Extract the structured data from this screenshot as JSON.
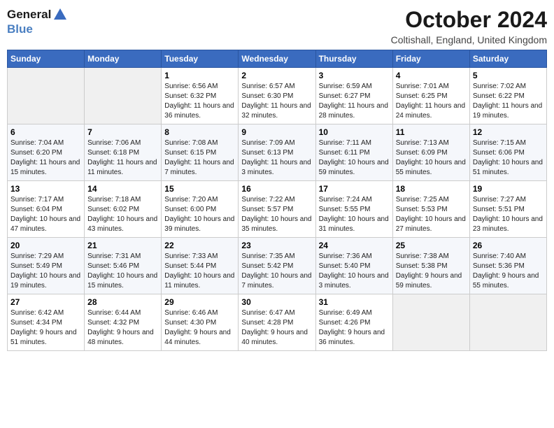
{
  "logo": {
    "general": "General",
    "blue": "Blue"
  },
  "title": "October 2024",
  "location": "Coltishall, England, United Kingdom",
  "headers": [
    "Sunday",
    "Monday",
    "Tuesday",
    "Wednesday",
    "Thursday",
    "Friday",
    "Saturday"
  ],
  "weeks": [
    [
      {
        "num": "",
        "info": ""
      },
      {
        "num": "",
        "info": ""
      },
      {
        "num": "1",
        "info": "Sunrise: 6:56 AM\nSunset: 6:32 PM\nDaylight: 11 hours and 36 minutes."
      },
      {
        "num": "2",
        "info": "Sunrise: 6:57 AM\nSunset: 6:30 PM\nDaylight: 11 hours and 32 minutes."
      },
      {
        "num": "3",
        "info": "Sunrise: 6:59 AM\nSunset: 6:27 PM\nDaylight: 11 hours and 28 minutes."
      },
      {
        "num": "4",
        "info": "Sunrise: 7:01 AM\nSunset: 6:25 PM\nDaylight: 11 hours and 24 minutes."
      },
      {
        "num": "5",
        "info": "Sunrise: 7:02 AM\nSunset: 6:22 PM\nDaylight: 11 hours and 19 minutes."
      }
    ],
    [
      {
        "num": "6",
        "info": "Sunrise: 7:04 AM\nSunset: 6:20 PM\nDaylight: 11 hours and 15 minutes."
      },
      {
        "num": "7",
        "info": "Sunrise: 7:06 AM\nSunset: 6:18 PM\nDaylight: 11 hours and 11 minutes."
      },
      {
        "num": "8",
        "info": "Sunrise: 7:08 AM\nSunset: 6:15 PM\nDaylight: 11 hours and 7 minutes."
      },
      {
        "num": "9",
        "info": "Sunrise: 7:09 AM\nSunset: 6:13 PM\nDaylight: 11 hours and 3 minutes."
      },
      {
        "num": "10",
        "info": "Sunrise: 7:11 AM\nSunset: 6:11 PM\nDaylight: 10 hours and 59 minutes."
      },
      {
        "num": "11",
        "info": "Sunrise: 7:13 AM\nSunset: 6:09 PM\nDaylight: 10 hours and 55 minutes."
      },
      {
        "num": "12",
        "info": "Sunrise: 7:15 AM\nSunset: 6:06 PM\nDaylight: 10 hours and 51 minutes."
      }
    ],
    [
      {
        "num": "13",
        "info": "Sunrise: 7:17 AM\nSunset: 6:04 PM\nDaylight: 10 hours and 47 minutes."
      },
      {
        "num": "14",
        "info": "Sunrise: 7:18 AM\nSunset: 6:02 PM\nDaylight: 10 hours and 43 minutes."
      },
      {
        "num": "15",
        "info": "Sunrise: 7:20 AM\nSunset: 6:00 PM\nDaylight: 10 hours and 39 minutes."
      },
      {
        "num": "16",
        "info": "Sunrise: 7:22 AM\nSunset: 5:57 PM\nDaylight: 10 hours and 35 minutes."
      },
      {
        "num": "17",
        "info": "Sunrise: 7:24 AM\nSunset: 5:55 PM\nDaylight: 10 hours and 31 minutes."
      },
      {
        "num": "18",
        "info": "Sunrise: 7:25 AM\nSunset: 5:53 PM\nDaylight: 10 hours and 27 minutes."
      },
      {
        "num": "19",
        "info": "Sunrise: 7:27 AM\nSunset: 5:51 PM\nDaylight: 10 hours and 23 minutes."
      }
    ],
    [
      {
        "num": "20",
        "info": "Sunrise: 7:29 AM\nSunset: 5:49 PM\nDaylight: 10 hours and 19 minutes."
      },
      {
        "num": "21",
        "info": "Sunrise: 7:31 AM\nSunset: 5:46 PM\nDaylight: 10 hours and 15 minutes."
      },
      {
        "num": "22",
        "info": "Sunrise: 7:33 AM\nSunset: 5:44 PM\nDaylight: 10 hours and 11 minutes."
      },
      {
        "num": "23",
        "info": "Sunrise: 7:35 AM\nSunset: 5:42 PM\nDaylight: 10 hours and 7 minutes."
      },
      {
        "num": "24",
        "info": "Sunrise: 7:36 AM\nSunset: 5:40 PM\nDaylight: 10 hours and 3 minutes."
      },
      {
        "num": "25",
        "info": "Sunrise: 7:38 AM\nSunset: 5:38 PM\nDaylight: 9 hours and 59 minutes."
      },
      {
        "num": "26",
        "info": "Sunrise: 7:40 AM\nSunset: 5:36 PM\nDaylight: 9 hours and 55 minutes."
      }
    ],
    [
      {
        "num": "27",
        "info": "Sunrise: 6:42 AM\nSunset: 4:34 PM\nDaylight: 9 hours and 51 minutes."
      },
      {
        "num": "28",
        "info": "Sunrise: 6:44 AM\nSunset: 4:32 PM\nDaylight: 9 hours and 48 minutes."
      },
      {
        "num": "29",
        "info": "Sunrise: 6:46 AM\nSunset: 4:30 PM\nDaylight: 9 hours and 44 minutes."
      },
      {
        "num": "30",
        "info": "Sunrise: 6:47 AM\nSunset: 4:28 PM\nDaylight: 9 hours and 40 minutes."
      },
      {
        "num": "31",
        "info": "Sunrise: 6:49 AM\nSunset: 4:26 PM\nDaylight: 9 hours and 36 minutes."
      },
      {
        "num": "",
        "info": ""
      },
      {
        "num": "",
        "info": ""
      }
    ]
  ]
}
